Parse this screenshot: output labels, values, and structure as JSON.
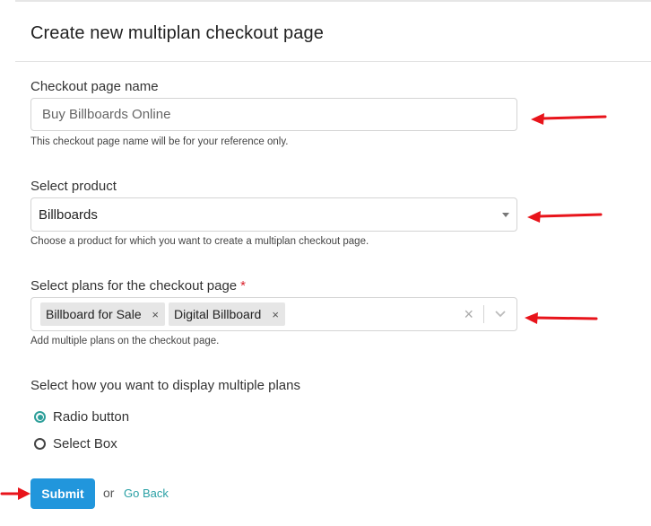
{
  "header": {
    "title": "Create new multiplan checkout page"
  },
  "checkout_name": {
    "label": "Checkout page name",
    "value": "Buy Billboards Online",
    "help": "This checkout page name will be for your reference only."
  },
  "product": {
    "label": "Select product",
    "selected": "Billboards",
    "help": "Choose a product for which you want to create a multiplan checkout page."
  },
  "plans": {
    "label": "Select plans for the checkout page",
    "required_mark": "*",
    "tags": [
      "Billboard for Sale",
      "Digital Billboard"
    ],
    "tag_remove": "×",
    "clear": "×",
    "help": "Add multiple plans on the checkout page."
  },
  "display": {
    "label": "Select how you want to display multiple plans",
    "options": [
      {
        "label": "Radio button",
        "checked": true
      },
      {
        "label": "Select Box",
        "checked": false
      }
    ]
  },
  "footer": {
    "submit": "Submit",
    "or": "or",
    "go_back": "Go Back"
  },
  "colors": {
    "accent": "#2196dc",
    "radio_checked": "#2e9f9a",
    "link": "#2aa0a5",
    "annotation_arrow": "#e8141b",
    "required": "#d9232d"
  },
  "icons": {
    "dropdown": "caret-down-icon",
    "multi_dropdown": "chevron-down-icon",
    "annotation": "red-arrow-icon"
  }
}
